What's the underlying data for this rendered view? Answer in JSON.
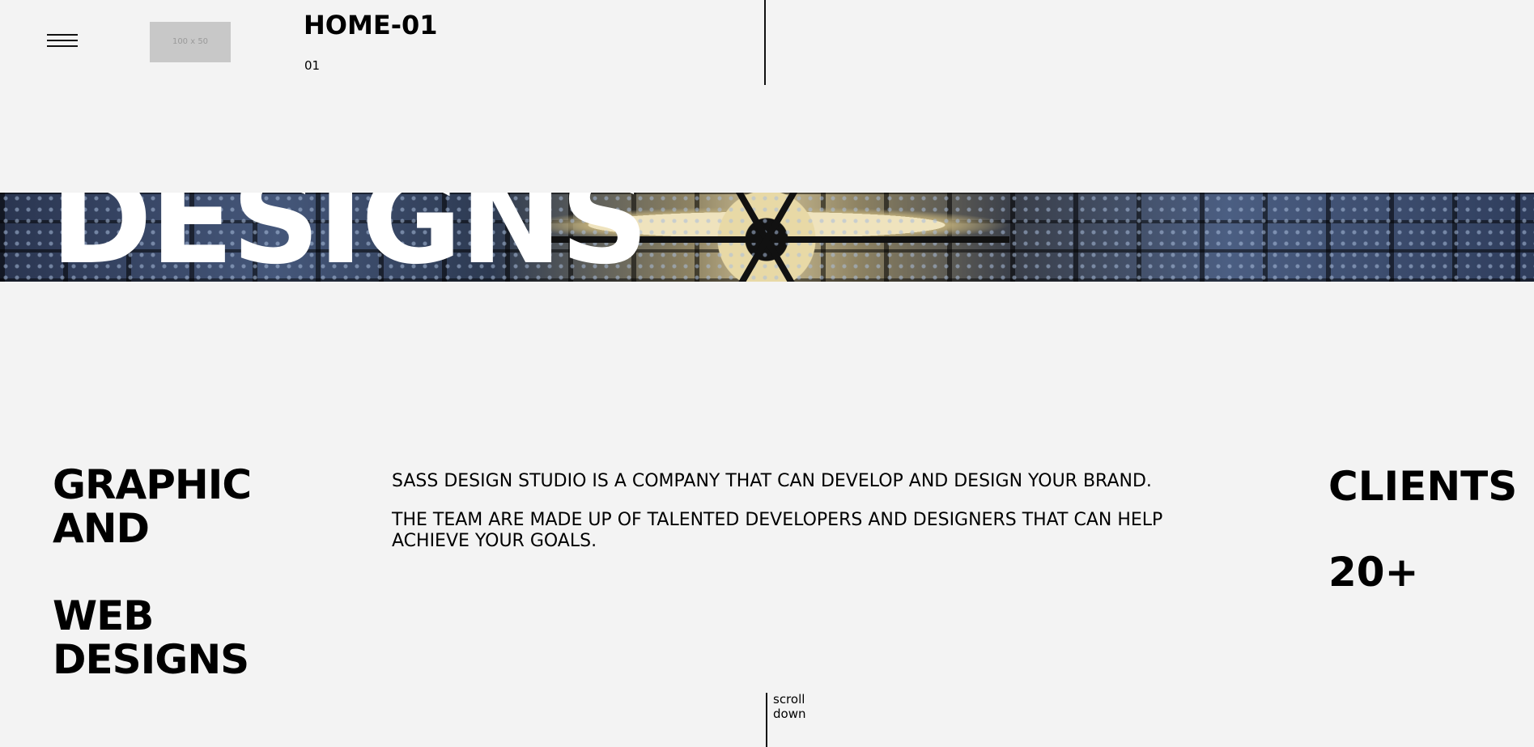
{
  "header": {
    "logo_placeholder": "100 x 50",
    "title": "HOME-01",
    "subtitle": "01"
  },
  "banner": {
    "word": "DESIGNS"
  },
  "services": {
    "line1": "GRAPHIC",
    "line2": "AND",
    "line3": "WEB",
    "line4": "DESIGNS"
  },
  "about": {
    "paragraph1": "SASS DESIGN STUDIO IS A COMPANY THAT CAN DEVELOP AND DESIGN YOUR BRAND.",
    "paragraph2": "THE TEAM ARE MADE UP OF TALENTED DEVELOPERS AND DESIGNERS THAT CAN HELP ACHIEVE YOUR GOALS."
  },
  "stats": {
    "label": "CLIENTS",
    "value": "20+"
  },
  "scroll": {
    "line1": "scroll",
    "line2": "down"
  },
  "icons": {
    "menu": "hamburger-menu-icon"
  }
}
